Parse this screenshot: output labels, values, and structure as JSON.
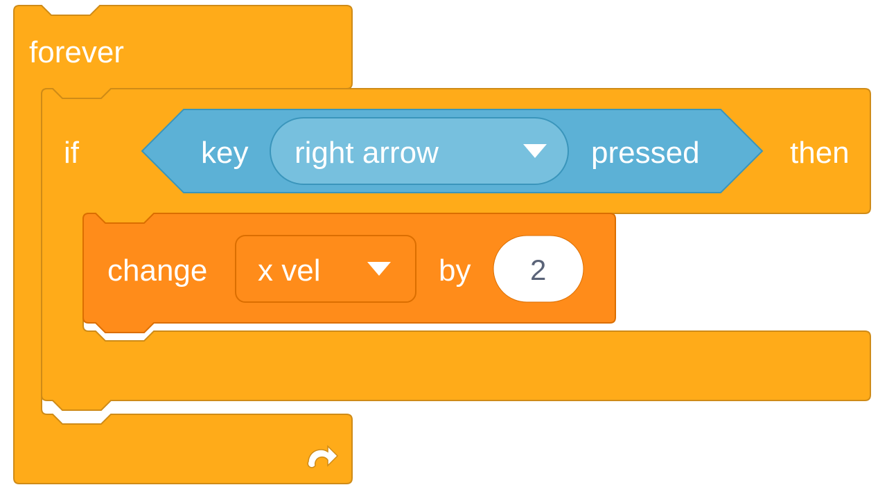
{
  "forever": {
    "label": "forever"
  },
  "if_block": {
    "if_label": "if",
    "then_label": "then"
  },
  "key_sensor": {
    "key_label": "key",
    "dropdown": "right arrow",
    "pressed_label": "pressed"
  },
  "change_block": {
    "change_label": "change",
    "var_dropdown": "x vel",
    "by_label": "by",
    "value": "2"
  },
  "colors": {
    "control": "#ffab19",
    "control_stroke": "#e09311",
    "sensing": "#5cb1d6",
    "sensing_stroke": "#3a95bb",
    "sensing_dropdown": "#77c0de",
    "data": "#ff8c1a",
    "data_stroke": "#e07a14",
    "data_dropdown": "#ff9933",
    "input_bg": "#ffffff"
  }
}
